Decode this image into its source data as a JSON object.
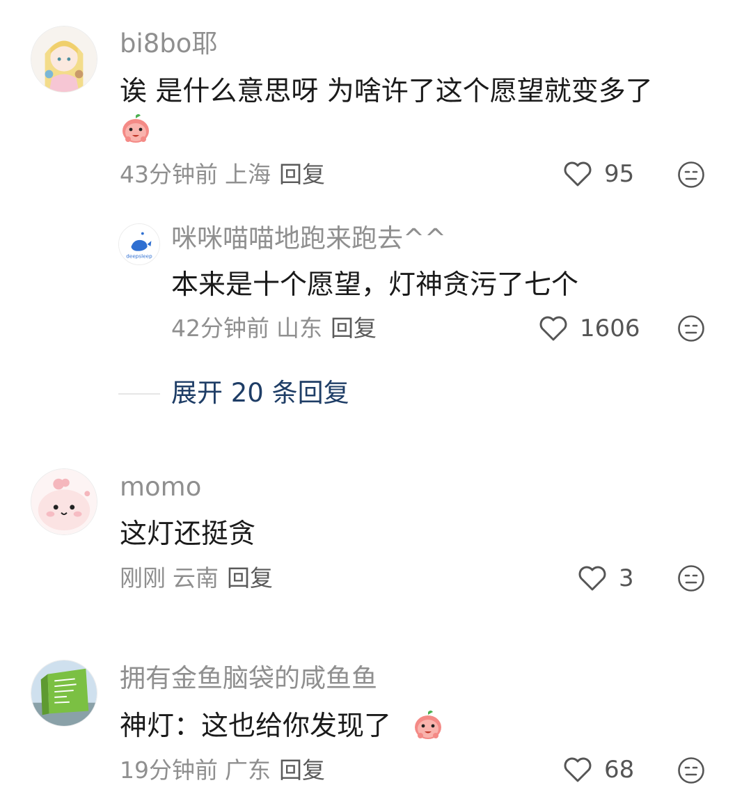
{
  "comments": [
    {
      "username": "bi8bo耶",
      "content": "诶 是什么意思呀 为啥许了这个愿望就变多了",
      "emoji": "peach-face-emoji",
      "time": "43分钟前",
      "location": "上海",
      "reply_label": "回复",
      "likes": "95"
    },
    {
      "username": "咪咪喵喵地跑来跑去^^",
      "content": "本来是十个愿望，灯神贪污了七个",
      "avatar_text": "deepsleep",
      "time": "42分钟前",
      "location": "山东",
      "reply_label": "回复",
      "likes": "1606"
    },
    {
      "username": "momo",
      "content": "这灯还挺贪",
      "time": "刚刚",
      "location": "云南",
      "reply_label": "回复",
      "likes": "3"
    },
    {
      "username": "拥有金鱼脑袋的咸鱼鱼",
      "content": "神灯：这也给你发现了",
      "emoji": "peach-face-emoji",
      "time": "19分钟前",
      "location": "广东",
      "reply_label": "回复",
      "likes": "68"
    }
  ],
  "expand_replies": "展开 20 条回复",
  "colors": {
    "username": "#8f8f8f",
    "content": "#1a1a1a",
    "meta": "#8f8f8f",
    "expand": "#1e3d66"
  }
}
